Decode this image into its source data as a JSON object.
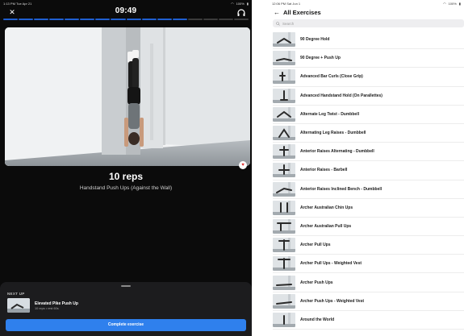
{
  "player": {
    "status": {
      "time": "1:13 PM",
      "date": "Tue Apr 21",
      "battery": "100%"
    },
    "timer": "09:49",
    "reps": "10 reps",
    "exercise_name": "Handstand Push Ups (Against the Wall)",
    "next_up": {
      "label": "NEXT UP",
      "title": "Elevated Pike Push Up",
      "subtitle": "10 reps • rest 60s"
    },
    "complete_button": "Complete exercise",
    "colors": {
      "accent": "#2f80ed",
      "favorite": "#d92b2b"
    }
  },
  "exercise_list": {
    "status": {
      "time": "12:06 PM",
      "date": "Sat Jun 1",
      "battery": "100%"
    },
    "title": "All Exercises",
    "search_placeholder": "Search",
    "items": [
      {
        "label": "90 Degree Hold"
      },
      {
        "label": "90 Degree + Push Up"
      },
      {
        "label": "Advanced Bar Curls (Close Grip)"
      },
      {
        "label": "Advanced Handstand Hold (On Parallettes)"
      },
      {
        "label": "Alternate Leg Twist - Dumbbell"
      },
      {
        "label": "Alternating Leg Raises - Dumbbell"
      },
      {
        "label": "Anterior Raises Alternating - Dumbbell"
      },
      {
        "label": "Anterior Raises - Barbell"
      },
      {
        "label": "Anterior Raises Inclined Bench - Dumbbell"
      },
      {
        "label": "Archer Australian Chin Ups"
      },
      {
        "label": "Archer Australian Pull Ups"
      },
      {
        "label": "Archer Pull Ups"
      },
      {
        "label": "Archer Pull Ups - Weighted Vest"
      },
      {
        "label": "Archer Push Ups"
      },
      {
        "label": "Archer Push Ups - Weighted Vest"
      },
      {
        "label": "Around the World"
      }
    ]
  }
}
